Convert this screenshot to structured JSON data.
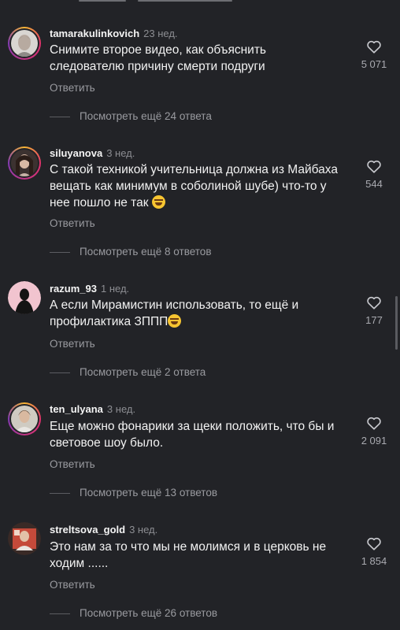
{
  "comments": [
    {
      "username": "tamarakulinkovich",
      "time": "23 нед.",
      "text": "Снимите второе видео, как объяснить следователю причину смерти подруги",
      "emoji": false,
      "likes": "5 071",
      "reply": "Ответить",
      "thread": "Посмотреть ещё 24 ответа"
    },
    {
      "username": "siluyanova",
      "time": "3 нед.",
      "text": "С такой техникой учительница должна из Майбаха вещать как минимум в соболиной шубе) что-то у нее пошло не так",
      "emoji": true,
      "likes": "544",
      "reply": "Ответить",
      "thread": "Посмотреть ещё 8 ответов"
    },
    {
      "username": "razum_93",
      "time": "1 нед.",
      "text": "А если Мирамистин использовать, то ещё и профилактика ЗППП",
      "emoji": true,
      "likes": "177",
      "reply": "Ответить",
      "thread": "Посмотреть ещё 2 ответа"
    },
    {
      "username": "ten_ulyana",
      "time": "3 нед.",
      "text": "Еще можно фонарики за щеки положить, что бы и световое шоу было.",
      "emoji": false,
      "likes": "2 091",
      "reply": "Ответить",
      "thread": "Посмотреть ещё 13 ответов"
    },
    {
      "username": "streltsova_gold",
      "time": "3 нед.",
      "text": "Это нам за то что мы не молимся и в церковь не ходим ......",
      "emoji": false,
      "likes": "1 854",
      "reply": "Ответить",
      "thread": "Посмотреть ещё 26 ответов"
    }
  ]
}
